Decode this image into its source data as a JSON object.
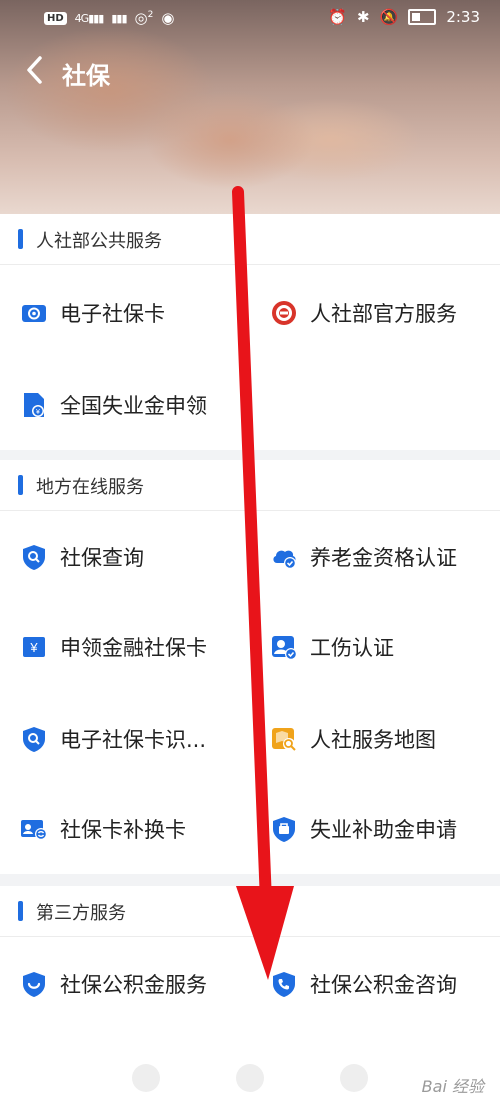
{
  "status_bar": {
    "hd": "HD",
    "signal1": "4G",
    "signal2": "2",
    "time": "2:33"
  },
  "header": {
    "title": "社保"
  },
  "sections": [
    {
      "title": "人社部公共服务",
      "items": [
        {
          "label": "电子社保卡",
          "icon": "social-card-icon"
        },
        {
          "label": "人社部官方服务",
          "icon": "ministry-emblem-icon"
        },
        {
          "label": "全国失业金申领",
          "icon": "document-money-icon"
        }
      ]
    },
    {
      "title": "地方在线服务",
      "items": [
        {
          "label": "社保查询",
          "icon": "shield-search-icon"
        },
        {
          "label": "养老金资格认证",
          "icon": "cloud-check-icon"
        },
        {
          "label": "申领金融社保卡",
          "icon": "yuan-card-icon"
        },
        {
          "label": "工伤认证",
          "icon": "user-check-icon"
        },
        {
          "label": "电子社保卡识...",
          "icon": "shield-search-icon"
        },
        {
          "label": "人社服务地图",
          "icon": "map-search-icon"
        },
        {
          "label": "社保卡补换卡",
          "icon": "card-replace-icon"
        },
        {
          "label": "失业补助金申请",
          "icon": "shield-bag-icon"
        }
      ]
    },
    {
      "title": "第三方服务",
      "items": [
        {
          "label": "社保公积金服务",
          "icon": "shield-smile-icon"
        },
        {
          "label": "社保公积金咨询",
          "icon": "shield-phone-icon"
        }
      ]
    }
  ],
  "watermark": "Bai 经验",
  "colors": {
    "accent": "#1f6de0",
    "arrow": "#e8141a",
    "icon_orange": "#f0a31b"
  }
}
